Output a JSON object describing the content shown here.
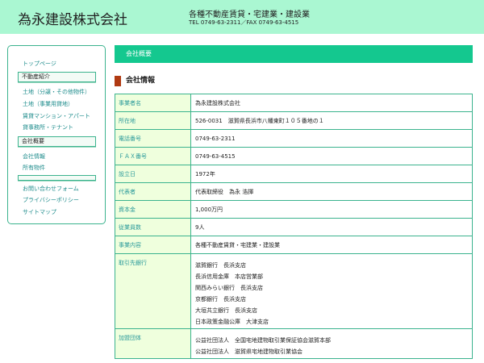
{
  "header": {
    "company_name": "為永建設株式会社",
    "tagline": "各種不動産賃貸・宅建業・建設業",
    "contact": "TEL 0749-63-2311／FAX 0749-63-4515"
  },
  "sidebar": {
    "top_link": "トップページ",
    "real_estate_heading": "不動産紹介",
    "real_estate_items": [
      "土地（分譲・その他物件）",
      "土地（事業用貸地）",
      "賃貸マンション・アパート",
      "貸事務所・テナント"
    ],
    "company_heading": "会社概要",
    "company_items": [
      "会社情報",
      "所有物件"
    ],
    "empty_heading": "",
    "footer_items": [
      "お問い合わせフォーム",
      "プライバシーポリシー",
      "サイトマップ"
    ]
  },
  "main": {
    "banner_title": "会社概要",
    "section_title": "会社情報",
    "rows": [
      {
        "label": "事業者名",
        "lines": [
          "為永建設株式会社"
        ]
      },
      {
        "label": "所在地",
        "lines": [
          "526-0031　滋賀県長浜市八幡東町１０５番地の１"
        ]
      },
      {
        "label": "電話番号",
        "lines": [
          "0749-63-2311"
        ]
      },
      {
        "label": "ＦＡＸ番号",
        "lines": [
          "0749-63-4515"
        ]
      },
      {
        "label": "設立日",
        "lines": [
          "1972年"
        ]
      },
      {
        "label": "代表者",
        "lines": [
          "代表取締役　為永 浩揮"
        ]
      },
      {
        "label": "資本金",
        "lines": [
          "1,000万円"
        ]
      },
      {
        "label": "従業員数",
        "lines": [
          "9人"
        ]
      },
      {
        "label": "事業内容",
        "lines": [
          "各種不動産賃貸・宅建業・建設業"
        ]
      },
      {
        "label": "取引先銀行",
        "lines": [
          "滋賀銀行　長浜支店",
          "長浜信用金庫　本店営業部",
          "関西みらい銀行　長浜支店",
          "京都銀行　長浜支店",
          "大垣共立銀行　長浜支店",
          "日本政策金融公庫　大津支店"
        ]
      },
      {
        "label": "加盟団体",
        "lines": [
          "公益社団法人　全国宅地建物取引業保証協会滋賀本部",
          "公益社団法人　滋賀県宅地建物取引業協会"
        ]
      }
    ]
  }
}
